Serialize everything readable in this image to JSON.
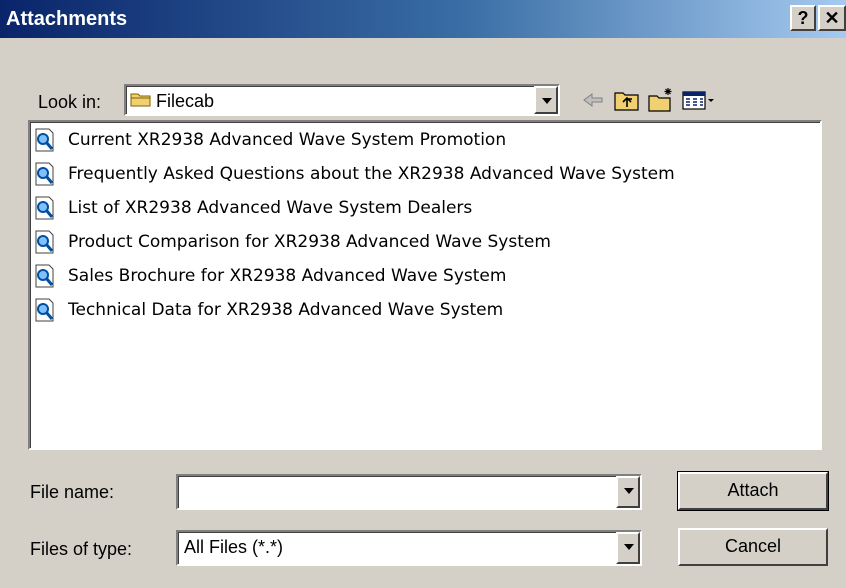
{
  "window": {
    "title": "Attachments",
    "help_label": "?",
    "close_label": "✕"
  },
  "lookin": {
    "label": "Look in:",
    "value": "Filecab"
  },
  "toolbar": {
    "icons": [
      "back-arrow-icon",
      "up-folder-icon",
      "new-folder-icon",
      "view-menu-icon"
    ]
  },
  "files": [
    "Current XR2938 Advanced Wave System Promotion",
    "Frequently Asked Questions about the XR2938 Advanced Wave System",
    "List of XR2938 Advanced Wave System Dealers",
    "Product Comparison for XR2938 Advanced Wave System",
    "Sales Brochure for XR2938 Advanced Wave System",
    "Technical Data for XR2938 Advanced Wave System"
  ],
  "filename": {
    "label": "File name:",
    "value": ""
  },
  "filetype": {
    "label": "Files of type:",
    "value": "All Files (*.*)"
  },
  "buttons": {
    "attach": "Attach",
    "cancel": "Cancel"
  }
}
